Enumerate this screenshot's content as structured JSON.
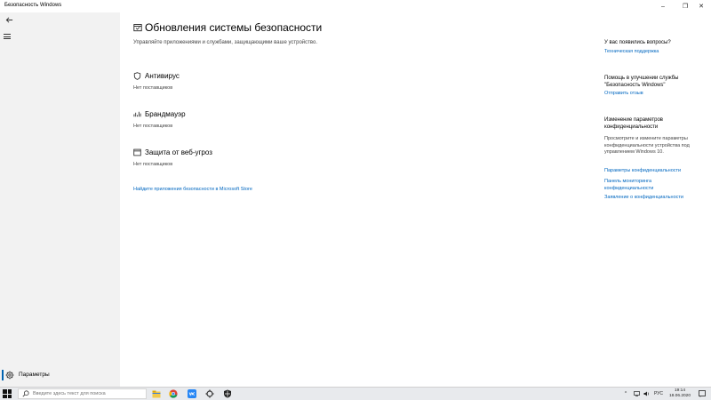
{
  "window": {
    "title": "Безопасность Windows",
    "controls": {
      "minimize": "–",
      "maximize": "❐",
      "close": "✕"
    }
  },
  "nav": {
    "back_icon": "back-arrow-icon",
    "menu_icon": "hamburger-icon",
    "settings_label": "Параметры",
    "accent_color": "#0063b1"
  },
  "page": {
    "title": "Обновления системы безопасности",
    "description": "Управляйте приложениями и службами, защищающими ваше устройство.",
    "sections": [
      {
        "icon": "shield-icon",
        "title": "Антивирус",
        "status": "Нет поставщиков"
      },
      {
        "icon": "firewall-signal-icon",
        "title": "Брандмауэр",
        "status": "Нет поставщиков"
      },
      {
        "icon": "browser-window-icon",
        "title": "Защита от веб-угроз",
        "status": "Нет поставщиков"
      }
    ],
    "store_link": "Найдите приложения безопасности в Microsoft Store"
  },
  "sidebar_right": {
    "help_heading": "У вас появились вопросы?",
    "help_link": "Техническая поддержка",
    "improve_heading": "Помощь в улучшении службы \"Безопасность Windows\"",
    "feedback_link": "Отправить отзыв",
    "privacy_heading": "Изменение параметров конфиденциальности",
    "privacy_text": "Просмотрите и измените параметры конфиденциальности устройства под управлением Windows 10.",
    "privacy_links": [
      "Параметры конфиденциальности",
      "Панель мониторинга конфиденциальности",
      "Заявление о конфиденциальности"
    ],
    "link_color": "#0067c0"
  },
  "taskbar": {
    "search_placeholder": "Введите здесь текст для поиска",
    "apps": [
      "file-explorer-icon",
      "chrome-icon",
      "vk-icon",
      "settings-gear-icon",
      "security-shield-icon"
    ],
    "tray": {
      "language": "РУС"
    },
    "clock": {
      "time": "19:14",
      "date": "18.06.2020"
    }
  }
}
